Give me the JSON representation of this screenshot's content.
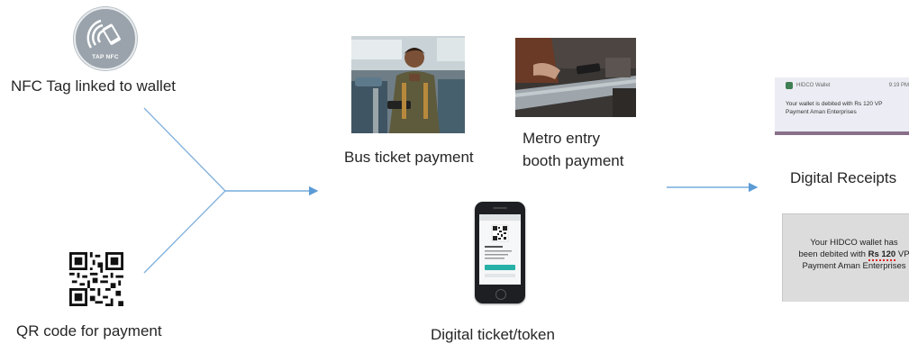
{
  "nfc": {
    "badge_text": "TAP NFC",
    "label": "NFC Tag linked to wallet"
  },
  "qr": {
    "label": "QR code for payment"
  },
  "use_cases": {
    "bus_label": "Bus ticket payment",
    "metro_label_line1": "Metro entry",
    "metro_label_line2": "booth payment",
    "digital_ticket_label": "Digital ticket/token"
  },
  "receipts": {
    "label": "Digital Receipts",
    "notification": {
      "app_name": "HIDCO Wallet",
      "time": "9:19 PM",
      "message_line1": "Your wallet is debited with Rs 120 VP",
      "message_line2": "Payment Aman Enterprises"
    },
    "sms": {
      "line1": "Your HIDCO  wallet has",
      "line2_prefix": "been debited with ",
      "line2_amount": "Rs 120",
      "line2_suffix": " VP",
      "line3": "Payment Aman Enterprises"
    }
  },
  "colors": {
    "connector": "#7fb0dd",
    "arrow": "#5b9bd5"
  }
}
